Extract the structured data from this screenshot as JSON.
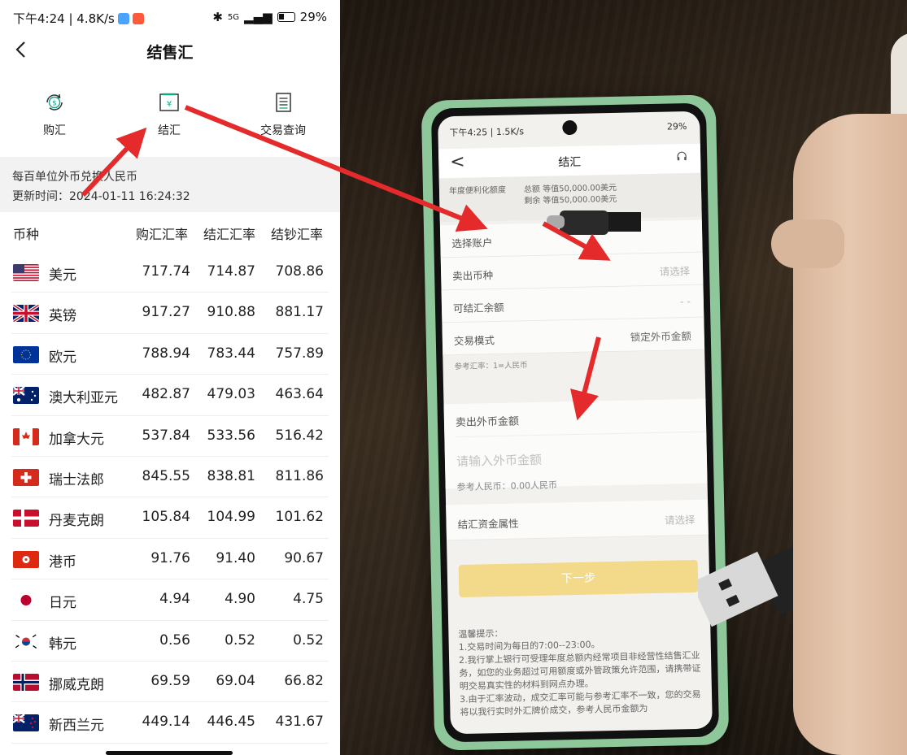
{
  "left_screen": {
    "status_bar": {
      "time_speed": "下午4:24 | 4.8K/s",
      "battery": "29%",
      "network": "5G"
    },
    "nav": {
      "back": "<",
      "title": "结售汇"
    },
    "tabs": [
      {
        "label": "购汇",
        "icon": "dollar-refresh-icon"
      },
      {
        "label": "结汇",
        "icon": "yuan-frame-icon"
      },
      {
        "label": "交易查询",
        "icon": "document-list-icon"
      }
    ],
    "info": {
      "unit_note": "每百单位外币兑换人民币",
      "update_time": "更新时间：2024-01-11 16:24:32"
    },
    "table": {
      "headers": [
        "币种",
        "购汇汇率",
        "结汇汇率",
        "结钞汇率"
      ],
      "rows": [
        {
          "name": "美元",
          "flag": "us",
          "buy": "717.74",
          "settle": "714.87",
          "cash": "708.86"
        },
        {
          "name": "英镑",
          "flag": "gb",
          "buy": "917.27",
          "settle": "910.88",
          "cash": "881.17"
        },
        {
          "name": "欧元",
          "flag": "eu",
          "buy": "788.94",
          "settle": "783.44",
          "cash": "757.89"
        },
        {
          "name": "澳大利亚元",
          "flag": "au",
          "buy": "482.87",
          "settle": "479.03",
          "cash": "463.64"
        },
        {
          "name": "加拿大元",
          "flag": "ca",
          "buy": "537.84",
          "settle": "533.56",
          "cash": "516.42"
        },
        {
          "name": "瑞士法郎",
          "flag": "ch",
          "buy": "845.55",
          "settle": "838.81",
          "cash": "811.86"
        },
        {
          "name": "丹麦克朗",
          "flag": "dk",
          "buy": "105.84",
          "settle": "104.99",
          "cash": "101.62"
        },
        {
          "name": "港币",
          "flag": "hk",
          "buy": "91.76",
          "settle": "91.40",
          "cash": "90.67"
        },
        {
          "name": "日元",
          "flag": "jp",
          "buy": "4.94",
          "settle": "4.90",
          "cash": "4.75"
        },
        {
          "name": "韩元",
          "flag": "kr",
          "buy": "0.56",
          "settle": "0.52",
          "cash": "0.52"
        },
        {
          "name": "挪威克朗",
          "flag": "no",
          "buy": "69.59",
          "settle": "69.04",
          "cash": "66.82"
        },
        {
          "name": "新西兰元",
          "flag": "nz",
          "buy": "449.14",
          "settle": "446.45",
          "cash": "431.67"
        }
      ]
    }
  },
  "right_photo": {
    "phone_screen": {
      "status": "下午4:25 | 1.5K/s",
      "status_right": "29%",
      "title": "结汇",
      "back": "<",
      "quota_label": "年度便利化额度",
      "quota_total": "总额 等值50,000.00美元",
      "quota_remaining": "剩余 等值50,000.00美元",
      "select_account": "选择账户",
      "sell_currency": "卖出币种",
      "placeholder_select": "请选择",
      "available_balance": "可结汇余额",
      "available_value": "- -",
      "trade_mode": "交易模式",
      "trade_mode_value": "锁定外币金额",
      "ref_rate": "参考汇率：1=人民币",
      "sell_amount": "卖出外币金额",
      "amount_placeholder": "请输入外币金额",
      "ref_rmb": "参考人民币：0.00人民币",
      "fund_attr": "结汇资金属性",
      "next_button": "下一步",
      "tips": [
        "温馨提示：",
        "1.交易时间为每日的7:00--23:00。",
        "2.我行掌上银行可受理年度总额内经常项目非经营性结售汇业务，如您的业务超过可用额度或外管政策允许范围，请携带证明交易真实性的材料到网点办理。",
        "3.由于汇率波动，成交汇率可能与参考汇率不一致，您的交易将以我行实时外汇牌价成交，参考人民币金额为"
      ]
    }
  },
  "colors": {
    "arrow": "#e42a2a",
    "next_button": "#f3d98a",
    "phone_case": "#8ec89a"
  }
}
